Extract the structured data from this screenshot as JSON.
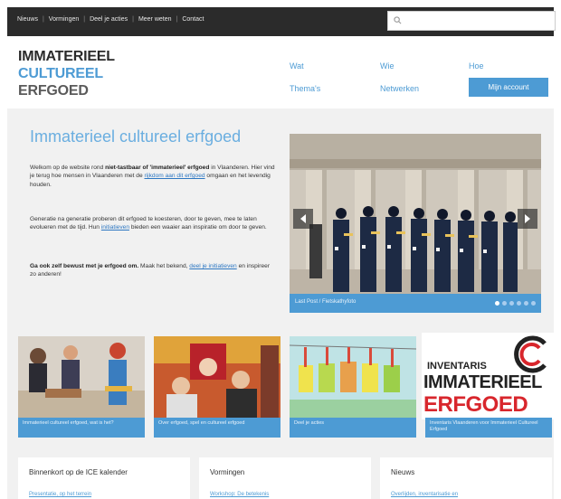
{
  "topnav": {
    "items": [
      "Nieuws",
      "Vormingen",
      "Deel je acties",
      "Meer weten",
      "Contact"
    ]
  },
  "search": {
    "placeholder": ""
  },
  "logo": {
    "line1": "IMMATERIEEL",
    "line2": "CULTUREEL",
    "line3": "ERFGOED"
  },
  "mainnav": {
    "wat": "Wat",
    "wie": "Wie",
    "hoe": "Hoe",
    "themas": "Thema's",
    "netwerken": "Netwerken",
    "account": "Mijn account"
  },
  "intro": {
    "title": "Immaterieel cultureel erfgoed",
    "p1_a": "Welkom op de website rond",
    "p1_b": "niet-tastbaar of 'immaterieel' erfgoed",
    "p1_c": "in Vlaanderen. Hier vind je terug hoe mensen in Vlaanderen met de",
    "p1_link": "rijkdom aan dit erfgoed",
    "p1_d": "omgaan en het levendig houden.",
    "p2_a": "Generatie na generatie proberen dit erfgoed te koesteren, door te geven, mee te laten evolueren met de tijd. Hun",
    "p2_link": "initiatieven",
    "p2_b": "bieden een waaier aan inspiratie om door te geven.",
    "p3_bold": "Ga ook zelf bewust met je erfgoed om.",
    "p3_a": "Maak het bekend,",
    "p3_link1": "deel je initiatieven",
    "p3_b": "en inspireer zo anderen!"
  },
  "slideshow": {
    "caption": "Last Post / Fietskathyfoto",
    "dot_count": 6,
    "active_dot": 0
  },
  "tiles": [
    {
      "caption": "Immaterieel cultureel erfgoed, wat is het?"
    },
    {
      "caption": "Over erfgoed, spel en cultureel erfgoed"
    },
    {
      "caption": "Deel je acties"
    },
    {
      "caption": "Inventaris Vlaanderen voor Immaterieel Cultureel Erfgoed"
    }
  ],
  "inventaris": {
    "line1": "INVENTARIS",
    "line2": "IMMATERIEEL",
    "line3": "ERFGOED"
  },
  "bottom": [
    {
      "title": "Binnenkort op de ICE kalender",
      "link": "Presentatie, op het terrein"
    },
    {
      "title": "Vormingen",
      "link": "Workshop: De betekenis"
    },
    {
      "title": "Nieuws",
      "link": "Overlijden, inventarisatie en"
    }
  ],
  "colors": {
    "accent": "#4d9bd4",
    "topbar": "#2b2b2b",
    "logo_red": "#d8262c"
  }
}
